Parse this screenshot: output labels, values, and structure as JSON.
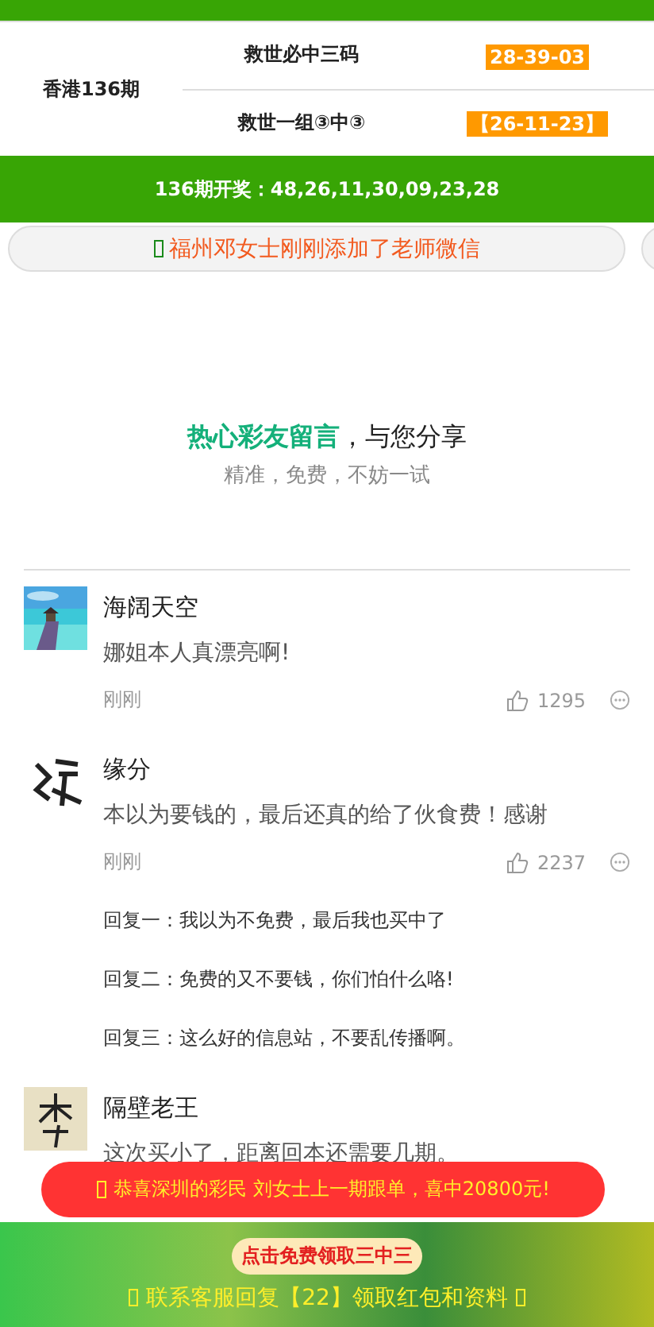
{
  "draw_table": {
    "period": "香港136期",
    "rows": [
      {
        "label": "救世必中三码",
        "value": "28-39-03"
      },
      {
        "label": "救世一组③中③",
        "value": "【26-11-23】"
      }
    ]
  },
  "result_bar": "136期开奖：48,26,11,30,09,23,28",
  "notice": "福州邓女士刚刚添加了老师微信",
  "section": {
    "title_highlight": "热心彩友留言",
    "title_rest": "，与您分享",
    "subtitle": "精准，免费，不妨一试"
  },
  "comments": [
    {
      "name": "海阔天空",
      "text": "娜姐本人真漂亮啊!",
      "time": "刚刚",
      "likes": "1295"
    },
    {
      "kind": "brush",
      "name": "缘分",
      "text": "本以为要钱的，最后还真的给了伙食费！感谢",
      "time": "刚刚",
      "likes": "2237",
      "replies": [
        "回复一：我以为不免费，最后我也买中了",
        "回复二：免费的又不要钱，你们怕什么咯!",
        "回复三：这么好的信息站，不要乱传播啊。"
      ]
    },
    {
      "kind": "tile",
      "name": "隔壁老王",
      "text": "这次买小了，距离回本还需要几期。"
    }
  ],
  "toast": "恭喜深圳的彩民 刘女士上一期跟单，喜中20800元!",
  "bottom_bar": {
    "button": "点击免费领取三中三",
    "contact": "联系客服回复【22】领取红包和资料"
  }
}
